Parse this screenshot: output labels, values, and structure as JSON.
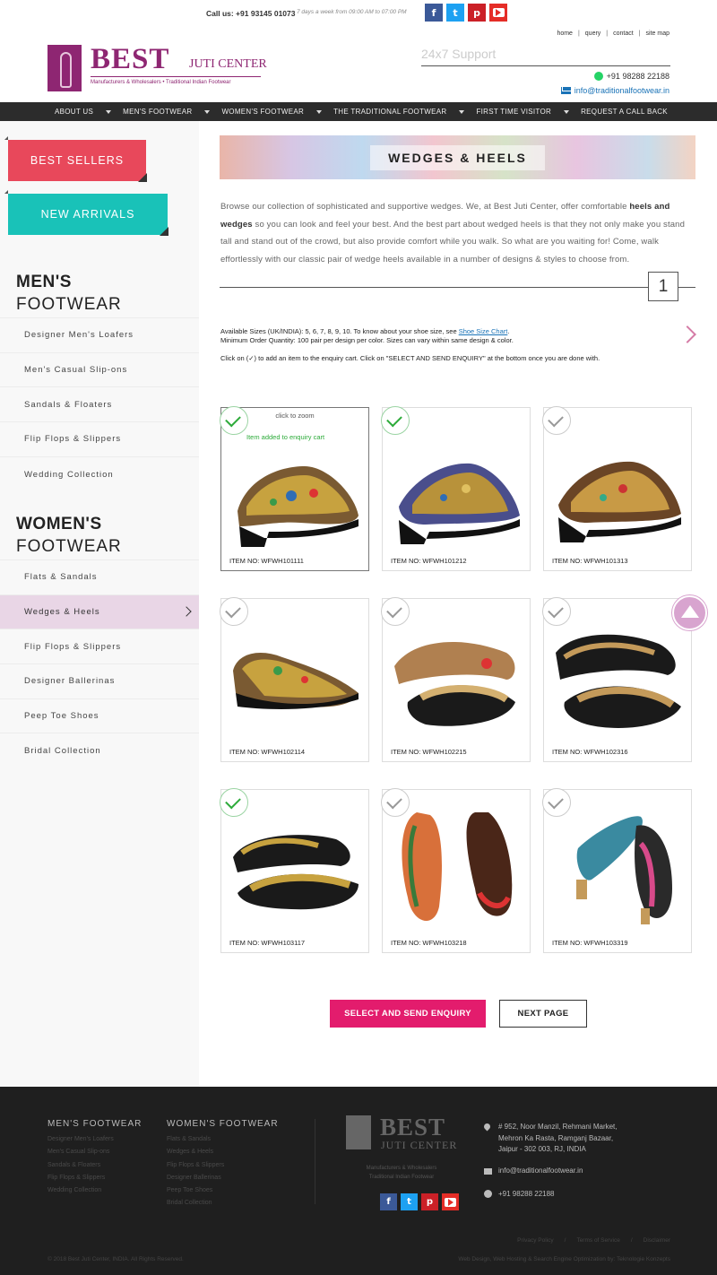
{
  "topbar": {
    "call_label": "Call us: +91 93145 01073",
    "hours": "7 days a week from 09:00 AM to 07:00 PM",
    "links": [
      "home",
      "query",
      "contact",
      "site map"
    ]
  },
  "logo": {
    "best": "BEST",
    "juti": "JUTI CENTER",
    "tagline": "Manufacturers & Wholesalers • Traditional Indian Footwear"
  },
  "support": {
    "title": "24x7 Support",
    "phone": "+91 98288 22188",
    "email": "info@traditionalfootwear.in"
  },
  "nav": [
    "ABOUT US",
    "MEN'S FOOTWEAR",
    "WOMEN'S FOOTWEAR",
    "THE TRADITIONAL FOOTWEAR",
    "FIRST TIME VISITOR",
    "REQUEST A CALL BACK"
  ],
  "sidebar": {
    "best_sellers": "BEST SELLERS",
    "new_arrivals": "NEW ARRIVALS",
    "mens_heading_bold": "MEN'S",
    "mens_heading_light": "FOOTWEAR",
    "mens_items": [
      "Designer Men's Loafers",
      "Men's Casual Slip-ons",
      "Sandals & Floaters",
      "Flip Flops & Slippers",
      "Wedding Collection"
    ],
    "womens_heading_bold": "WOMEN'S",
    "womens_heading_light": "FOOTWEAR",
    "womens_items": [
      "Flats & Sandals",
      "Wedges & Heels",
      "Flip Flops & Slippers",
      "Designer Ballerinas",
      "Peep Toe Shoes",
      "Bridal Collection"
    ],
    "active_item": "Wedges & Heels"
  },
  "main": {
    "banner_title": "WEDGES & HEELS",
    "intro_1": "Browse our collection of sophisticated and supportive wedges. We, at Best Juti Center, offer comfortable ",
    "intro_bold_1": "heels and wedges",
    "intro_2": " so you can look and feel your best. And the best part about wedged heels is that they not only make you stand tall and stand out of the crowd, but also provide comfort while you walk. So what are you waiting for! Come, walk effortlessly with our classic pair of wedge heels available in a number of designs & styles to choose from.",
    "page_number": "1",
    "sizes_text": "Available Sizes (UK/INDIA): 5, 6, 7, 8, 9, 10. To know about your shoe size, see ",
    "size_chart_link": "Shoe Size Chart",
    "min_order": "Minimum Order Quantity: 100 pair per design per color. Sizes can vary within same design & color.",
    "click_help": "Click on (✓) to add an item to the enquiry cart. Click on \"SELECT AND SEND ENQUIRY\" at the bottom once you are done with.",
    "zoom_hint": "click to zoom",
    "added_msg": "Item added to enquiry cart",
    "products": [
      {
        "item": "ITEM NO: WFWH101111",
        "checked": true
      },
      {
        "item": "ITEM NO: WFWH101212",
        "checked": true
      },
      {
        "item": "ITEM NO: WFWH101313",
        "checked": false
      },
      {
        "item": "ITEM NO: WFWH102114",
        "checked": false
      },
      {
        "item": "ITEM NO: WFWH102215",
        "checked": false
      },
      {
        "item": "ITEM NO: WFWH102316",
        "checked": false
      },
      {
        "item": "ITEM NO: WFWH103117",
        "checked": true
      },
      {
        "item": "ITEM NO: WFWH103218",
        "checked": false
      },
      {
        "item": "ITEM NO: WFWH103319",
        "checked": false
      }
    ],
    "btn_enquiry": "SELECT AND SEND ENQUIRY",
    "btn_next": "NEXT PAGE"
  },
  "footer": {
    "mens_title": "MEN'S FOOTWEAR",
    "mens_items": [
      "Designer Men's Loafers",
      "Men's Casual Slip-ons",
      "Sandals & Floaters",
      "Flip Flops & Slippers",
      "Wedding Collection"
    ],
    "womens_title": "WOMEN'S FOOTWEAR",
    "womens_items": [
      "Flats & Sandals",
      "Wedges & Heels",
      "Flip Flops & Slippers",
      "Designer Ballerinas",
      "Peep Toe Shoes",
      "Bridal Collection"
    ],
    "logo_best": "BEST",
    "logo_juti": "JUTI CENTER",
    "logo_tag_1": "Manufacturers & Wholesalers",
    "logo_tag_2": "Traditional Indian Footwear",
    "addr_1": "# 952, Noor Manzil, Rehmani Market,",
    "addr_2": "Mehron Ka Rasta, Ramganj Bazaar,",
    "addr_3": "Jaipur - 302 003, RJ, INDIA",
    "email": "info@traditionalfootwear.in",
    "phone": "+91 98288 22188",
    "links": [
      "Privacy Policy",
      "Terms of Service",
      "Disclaimer"
    ],
    "copyright": "© 2018 Best Juti Center, INDIA. All Rights Reserved.",
    "credit": "Web Design, Web Hosting & Search Engine Optimization by: Teknologie Konzepts"
  },
  "colors": {
    "brand": "#8e2672",
    "best_sellers": "#e8485b",
    "new_arrivals": "#19c2b8",
    "enquiry_button": "#e31c6d",
    "nav_bg": "#2c2c2c",
    "footer_bg": "#1f1f1f",
    "active_bg": "#e9d6e6"
  }
}
